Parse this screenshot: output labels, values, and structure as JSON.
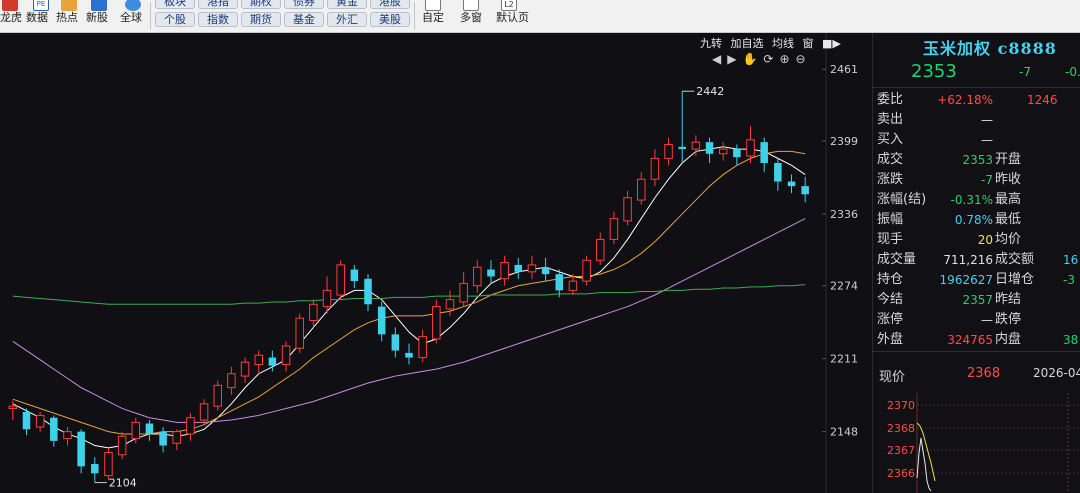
{
  "toolbar": {
    "icons": [
      {
        "label": "龙虎",
        "icon": "dragon-tiger-icon"
      },
      {
        "label": "数据",
        "icon": "pe-data-icon"
      },
      {
        "label": "热点",
        "icon": "hotspot-icon"
      },
      {
        "label": "新股",
        "icon": "new-stock-icon"
      },
      {
        "label": "全球",
        "icon": "globe-icon"
      }
    ],
    "buttons_row1": [
      "板块",
      "港指",
      "期权",
      "债券",
      "黄金",
      "港股"
    ],
    "buttons_row2": [
      "个股",
      "指数",
      "期货",
      "基金",
      "外汇",
      "美股"
    ],
    "right_icons": [
      {
        "label": "自定",
        "icon": "custom-icon"
      },
      {
        "label": "多窗",
        "icon": "multi-window-icon"
      },
      {
        "label": "默认页",
        "icon": "l2-default-icon",
        "badge": "L2"
      }
    ]
  },
  "chart_tools": [
    "九转",
    "加自选",
    "均线",
    "窗"
  ],
  "chart_data": {
    "type": "candlestick",
    "y_axis_labels": [
      "2461",
      "2399",
      "2336",
      "2274",
      "2211",
      "2148"
    ],
    "ylim": [
      2095,
      2475
    ],
    "annotations": [
      {
        "label": "2442",
        "value": 2442,
        "bar": 49
      },
      {
        "label": "2104",
        "value": 2104,
        "bar": 6
      }
    ],
    "candles": [
      [
        2168,
        2170,
        2158,
        2175
      ],
      [
        2165,
        2150,
        2145,
        2168
      ],
      [
        2152,
        2162,
        2148,
        2165
      ],
      [
        2160,
        2140,
        2135,
        2162
      ],
      [
        2142,
        2148,
        2136,
        2152
      ],
      [
        2148,
        2118,
        2112,
        2150
      ],
      [
        2120,
        2112,
        2104,
        2126
      ],
      [
        2110,
        2130,
        2106,
        2134
      ],
      [
        2128,
        2144,
        2124,
        2148
      ],
      [
        2142,
        2156,
        2138,
        2160
      ],
      [
        2155,
        2146,
        2140,
        2158
      ],
      [
        2148,
        2136,
        2130,
        2152
      ],
      [
        2138,
        2148,
        2132,
        2150
      ],
      [
        2146,
        2160,
        2140,
        2164
      ],
      [
        2158,
        2172,
        2154,
        2176
      ],
      [
        2170,
        2188,
        2166,
        2192
      ],
      [
        2186,
        2198,
        2180,
        2204
      ],
      [
        2196,
        2208,
        2190,
        2212
      ],
      [
        2206,
        2214,
        2198,
        2218
      ],
      [
        2212,
        2205,
        2200,
        2218
      ],
      [
        2206,
        2222,
        2200,
        2226
      ],
      [
        2220,
        2246,
        2216,
        2250
      ],
      [
        2244,
        2258,
        2238,
        2262
      ],
      [
        2256,
        2270,
        2250,
        2282
      ],
      [
        2266,
        2292,
        2262,
        2296
      ],
      [
        2288,
        2278,
        2272,
        2292
      ],
      [
        2280,
        2258,
        2252,
        2284
      ],
      [
        2256,
        2232,
        2226,
        2260
      ],
      [
        2232,
        2218,
        2212,
        2238
      ],
      [
        2216,
        2212,
        2206,
        2224
      ],
      [
        2212,
        2230,
        2208,
        2236
      ],
      [
        2228,
        2256,
        2224,
        2262
      ],
      [
        2254,
        2262,
        2248,
        2270
      ],
      [
        2260,
        2276,
        2256,
        2286
      ],
      [
        2274,
        2290,
        2268,
        2296
      ],
      [
        2288,
        2282,
        2276,
        2296
      ],
      [
        2280,
        2294,
        2274,
        2300
      ],
      [
        2292,
        2286,
        2280,
        2298
      ],
      [
        2286,
        2292,
        2280,
        2300
      ],
      [
        2290,
        2284,
        2278,
        2298
      ],
      [
        2284,
        2270,
        2264,
        2288
      ],
      [
        2270,
        2278,
        2266,
        2284
      ],
      [
        2278,
        2296,
        2274,
        2300
      ],
      [
        2296,
        2314,
        2292,
        2320
      ],
      [
        2314,
        2332,
        2310,
        2338
      ],
      [
        2330,
        2350,
        2326,
        2356
      ],
      [
        2348,
        2366,
        2344,
        2372
      ],
      [
        2366,
        2384,
        2360,
        2392
      ],
      [
        2384,
        2396,
        2378,
        2402
      ],
      [
        2394,
        2392,
        2380,
        2442
      ],
      [
        2392,
        2398,
        2386,
        2404
      ],
      [
        2398,
        2388,
        2380,
        2402
      ],
      [
        2388,
        2392,
        2382,
        2398
      ],
      [
        2392,
        2385,
        2378,
        2396
      ],
      [
        2386,
        2400,
        2380,
        2412
      ],
      [
        2398,
        2380,
        2372,
        2402
      ],
      [
        2380,
        2364,
        2356,
        2384
      ],
      [
        2364,
        2360,
        2354,
        2370
      ],
      [
        2360,
        2353,
        2346,
        2368
      ]
    ],
    "ma_lines": [
      {
        "color": "#ffffff",
        "values": [
          2172,
          2166,
          2160,
          2152,
          2146,
          2142,
          2136,
          2134,
          2136,
          2142,
          2146,
          2146,
          2144,
          2146,
          2150,
          2160,
          2172,
          2186,
          2198,
          2204,
          2210,
          2224,
          2238,
          2252,
          2264,
          2270,
          2270,
          2262,
          2248,
          2234,
          2224,
          2228,
          2238,
          2250,
          2264,
          2276,
          2282,
          2286,
          2288,
          2290,
          2286,
          2282,
          2280,
          2286,
          2298,
          2314,
          2332,
          2350,
          2366,
          2380,
          2390,
          2392,
          2394,
          2392,
          2392,
          2390,
          2384,
          2378,
          2370
        ]
      },
      {
        "color": "#e8a33a",
        "values": [
          2176,
          2172,
          2168,
          2164,
          2160,
          2156,
          2152,
          2148,
          2146,
          2146,
          2146,
          2148,
          2148,
          2150,
          2154,
          2160,
          2166,
          2172,
          2178,
          2186,
          2194,
          2202,
          2212,
          2220,
          2228,
          2236,
          2242,
          2246,
          2248,
          2248,
          2248,
          2250,
          2252,
          2256,
          2260,
          2266,
          2270,
          2274,
          2276,
          2278,
          2280,
          2282,
          2282,
          2284,
          2288,
          2294,
          2302,
          2312,
          2324,
          2336,
          2348,
          2360,
          2370,
          2378,
          2384,
          2388,
          2390,
          2390,
          2388
        ]
      },
      {
        "color": "#c78de0",
        "values": [
          2226,
          2218,
          2210,
          2202,
          2194,
          2186,
          2180,
          2174,
          2168,
          2164,
          2160,
          2158,
          2156,
          2156,
          2156,
          2157,
          2158,
          2160,
          2162,
          2165,
          2168,
          2171,
          2174,
          2178,
          2182,
          2186,
          2190,
          2193,
          2196,
          2198,
          2200,
          2202,
          2205,
          2208,
          2212,
          2216,
          2220,
          2224,
          2228,
          2232,
          2236,
          2240,
          2244,
          2248,
          2252,
          2256,
          2261,
          2266,
          2272,
          2278,
          2284,
          2290,
          2296,
          2302,
          2308,
          2314,
          2320,
          2326,
          2332
        ]
      },
      {
        "color": "#3fae4a",
        "values": [
          2265,
          2264,
          2263,
          2262,
          2261,
          2260,
          2259,
          2258,
          2258,
          2258,
          2258,
          2258,
          2258,
          2258,
          2258,
          2258,
          2258,
          2259,
          2259,
          2260,
          2260,
          2261,
          2261,
          2262,
          2262,
          2263,
          2263,
          2263,
          2264,
          2264,
          2264,
          2265,
          2265,
          2265,
          2265,
          2266,
          2266,
          2266,
          2266,
          2266,
          2267,
          2267,
          2267,
          2268,
          2268,
          2268,
          2269,
          2269,
          2270,
          2270,
          2271,
          2271,
          2272,
          2272,
          2273,
          2273,
          2274,
          2274,
          2275
        ]
      }
    ]
  },
  "panel": {
    "title": "玉米加权 c8888",
    "price": "2353",
    "change": "-7",
    "change_pct": "-0.",
    "rows": [
      {
        "k": "委比",
        "v1": "+62.18%",
        "v1c": "red",
        "k2": "",
        "v2": "1246",
        "v2c": "red"
      },
      {
        "k": "卖出",
        "v1": "—",
        "v1c": "white",
        "k2": "",
        "v2": "",
        "v2c": "white"
      },
      {
        "k": "买入",
        "v1": "—",
        "v1c": "white",
        "k2": "",
        "v2": "",
        "v2c": "white"
      },
      {
        "k": "成交",
        "v1": "2353",
        "v1c": "green",
        "k2": "开盘",
        "v2": "",
        "v2c": "white"
      },
      {
        "k": "涨跌",
        "v1": "-7",
        "v1c": "green",
        "k2": "昨收",
        "v2": "",
        "v2c": "white"
      },
      {
        "k": "涨幅(结)",
        "v1": "-0.31%",
        "v1c": "green",
        "k2": "最高",
        "v2": "",
        "v2c": "white"
      },
      {
        "k": "振幅",
        "v1": "0.78%",
        "v1c": "cyan",
        "k2": "最低",
        "v2": "",
        "v2c": "white"
      },
      {
        "k": "现手",
        "v1": "20",
        "v1c": "yellow",
        "k2": "均价",
        "v2": "",
        "v2c": "white"
      },
      {
        "k": "成交量",
        "v1": "711,216",
        "v1c": "white",
        "k2": "成交额",
        "v2": "16",
        "v2c": "cyan"
      },
      {
        "k": "持仓",
        "v1": "1962627",
        "v1c": "cyan",
        "k2": "日增仓",
        "v2": "-3",
        "v2c": "green"
      },
      {
        "k": "今结",
        "v1": "2357",
        "v1c": "green",
        "k2": "昨结",
        "v2": "",
        "v2c": "white"
      },
      {
        "k": "涨停",
        "v1": "—",
        "v1c": "white",
        "k2": "跌停",
        "v2": "",
        "v2c": "white"
      },
      {
        "k": "外盘",
        "v1": "324765",
        "v1c": "red",
        "k2": "内盘",
        "v2": "38",
        "v2c": "green"
      }
    ],
    "now_label": "现价",
    "now_price": "2368",
    "date": "2026-04-",
    "mini_axis": [
      "2370",
      "2368",
      "2367",
      "2366"
    ]
  }
}
